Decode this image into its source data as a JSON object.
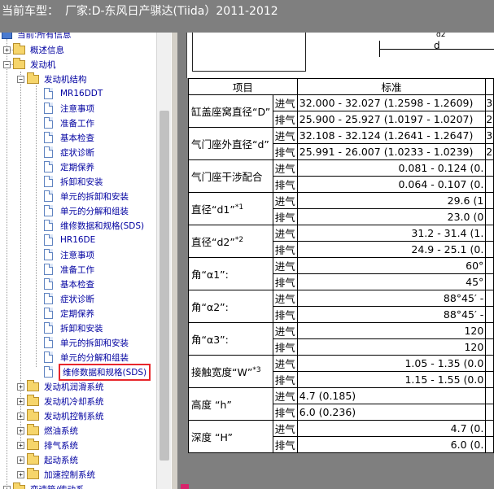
{
  "title_bar": {
    "vehicle_label": "当前车型：",
    "vehicle_text": "厂家:D-东风日产骐达(Tiida）2011-2012"
  },
  "tree": {
    "root_label": "当前:所有信息",
    "items": [
      {
        "label": "概述信息"
      },
      {
        "label": "发动机"
      },
      {
        "label": "发动机结构"
      },
      {
        "label": "MR16DDT"
      },
      {
        "label": "注意事项"
      },
      {
        "label": "准备工作"
      },
      {
        "label": "基本检查"
      },
      {
        "label": "症状诊断"
      },
      {
        "label": "定期保养"
      },
      {
        "label": "拆卸和安装"
      },
      {
        "label": "单元的拆卸和安装"
      },
      {
        "label": "单元的分解和组装"
      },
      {
        "label": "维修数据和规格(SDS)"
      },
      {
        "label": "HR16DE"
      },
      {
        "label": "注意事项"
      },
      {
        "label": "准备工作"
      },
      {
        "label": "基本检查"
      },
      {
        "label": "症状诊断"
      },
      {
        "label": "定期保养"
      },
      {
        "label": "拆卸和安装"
      },
      {
        "label": "单元的拆卸和安装"
      },
      {
        "label": "单元的分解和组装"
      },
      {
        "label": "维修数据和规格(SDS)"
      },
      {
        "label": "发动机润滑系统"
      },
      {
        "label": "发动机冷却系统"
      },
      {
        "label": "发动机控制系统"
      },
      {
        "label": "燃油系统"
      },
      {
        "label": "排气系统"
      },
      {
        "label": "起动系统"
      },
      {
        "label": "加速控制系统"
      },
      {
        "label": "变速箱/传动系"
      }
    ]
  },
  "figure": {
    "dim_label": "d",
    "dim_label_top": "d2"
  },
  "table": {
    "header_item": "项目",
    "header_standard": "标准",
    "rows": [
      {
        "item": "缸盖座窝直径“D”",
        "sub": "进气",
        "value": "32.000 - 32.027 (1.2598 - 1.2609)",
        "extra": "3"
      },
      {
        "sub": "排气",
        "value": "25.900 - 25.927 (1.0197 - 1.0207)",
        "extra": "2"
      },
      {
        "item": "气门座外直径“d”",
        "sub": "进气",
        "value": "32.108 - 32.124 (1.2641 - 1.2647)",
        "extra": "3"
      },
      {
        "sub": "排气",
        "value": "25.991 - 26.007 (1.0233 - 1.0239)",
        "extra": "2"
      },
      {
        "item": "气门座干涉配合",
        "sub": "进气",
        "value": "0.081 - 0.124 (0.",
        "extra": ""
      },
      {
        "sub": "排气",
        "value": "0.064 - 0.107 (0.",
        "extra": ""
      },
      {
        "item": "直径“d1”",
        "item_sup": "*1",
        "sub": "进气",
        "value": "29.6 (1",
        "extra": ""
      },
      {
        "sub": "排气",
        "value": "23.0 (0",
        "extra": ""
      },
      {
        "item": "直径“d2”",
        "item_sup": "*2",
        "sub": "进气",
        "value": "31.2 - 31.4 (1.",
        "extra": ""
      },
      {
        "sub": "排气",
        "value": "24.9 - 25.1 (0.",
        "extra": ""
      },
      {
        "item": "角“α1”:",
        "sub": "进气",
        "value": "60°",
        "extra": ""
      },
      {
        "sub": "排气",
        "value": "45°",
        "extra": ""
      },
      {
        "item": "角“α2”:",
        "sub": "进气",
        "value": "88°45′ -",
        "extra": ""
      },
      {
        "sub": "排气",
        "value": "88°45′ -",
        "extra": ""
      },
      {
        "item": "角“α3”:",
        "sub": "进气",
        "value": "120",
        "extra": ""
      },
      {
        "sub": "排气",
        "value": "120",
        "extra": ""
      },
      {
        "item": "接触宽度“W”",
        "item_sup": "*3",
        "sub": "进气",
        "value": "1.05 - 1.35 (0.0",
        "extra": ""
      },
      {
        "sub": "排气",
        "value": "1.15 - 1.55 (0.0",
        "extra": ""
      },
      {
        "item": "高度 “h”",
        "sub": "进气",
        "value": "4.7 (0.185)",
        "extra": ""
      },
      {
        "sub": "排气",
        "value": "6.0 (0.236)",
        "extra": ""
      },
      {
        "item": "深度 “H”",
        "sub": "进气",
        "value": "4.7 (0.",
        "extra": ""
      },
      {
        "sub": "排气",
        "value": "6.0 (0.",
        "extra": ""
      }
    ]
  }
}
